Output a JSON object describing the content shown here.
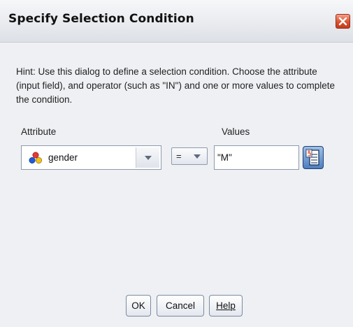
{
  "dialog": {
    "title": "Specify Selection Condition",
    "hint": "Hint: Use this dialog to define a selection condition.  Choose the attribute (input field), and operator (such as \"IN\") and one or more values to complete the condition."
  },
  "attribute": {
    "label": "Attribute",
    "selected": "gender",
    "icon": "nominal-field-icon"
  },
  "operator": {
    "selected": "="
  },
  "values": {
    "label": "Values",
    "value": "\"M\"",
    "picker_icon": "value-list-icon"
  },
  "buttons": {
    "ok": "OK",
    "cancel": "Cancel",
    "help": "Help"
  },
  "colors": {
    "close": "#d9532f",
    "panel": "#eef0f3",
    "picker": "#4d7fc0"
  }
}
